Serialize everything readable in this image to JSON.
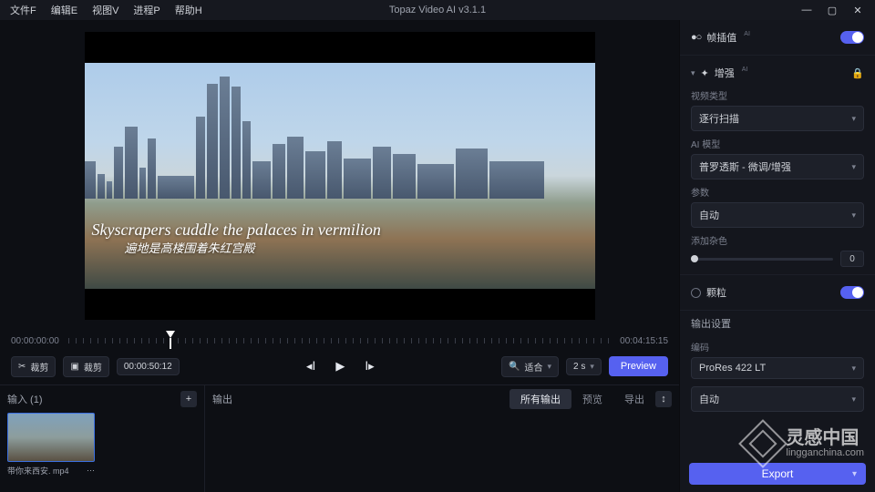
{
  "titlebar": {
    "menus": [
      "文件F",
      "编辑E",
      "视图V",
      "进程P",
      "帮助H"
    ],
    "app_title": "Topaz Video AI  v3.1.1"
  },
  "preview": {
    "subtitle_en": "Skyscrapers cuddle the palaces in vermilion",
    "subtitle_cn": "遍地是高楼围着朱红宫殿"
  },
  "timeline": {
    "start": "00:00:00:00",
    "end": "00:04:15:15"
  },
  "controls": {
    "trim1_icon_label": "裁剪",
    "trim2_icon_label": "裁剪",
    "timecode": "00:00:50:12",
    "zoom_label": "适合",
    "speed_label": "2 s",
    "preview_btn": "Preview"
  },
  "input_panel": {
    "header": "输入 (1)",
    "thumb_name": "带你来西安. mp4"
  },
  "output_panel": {
    "header": "输出",
    "tabs": {
      "all": "所有输出",
      "preview": "预览",
      "export": "导出"
    }
  },
  "sidebar": {
    "frame_interp": {
      "title": "帧插值"
    },
    "enhance": {
      "title": "增强",
      "video_type_label": "视频类型",
      "video_type_value": "逐行扫描",
      "ai_model_label": "AI 模型",
      "ai_model_value": "普罗透斯 - 微调/增强",
      "params_label": "参数",
      "params_value": "自动",
      "extra_tone_label": "添加杂色",
      "extra_tone_value": "0"
    },
    "grain": {
      "title": "颗粒"
    },
    "output_settings": {
      "header": "输出设置",
      "codec_label": "编码",
      "codec_value": "ProRes 422 LT",
      "auto": "自动"
    },
    "export_btn": "Export"
  },
  "watermark": {
    "cn": "灵感中国",
    "en": "lingganchina.com"
  }
}
